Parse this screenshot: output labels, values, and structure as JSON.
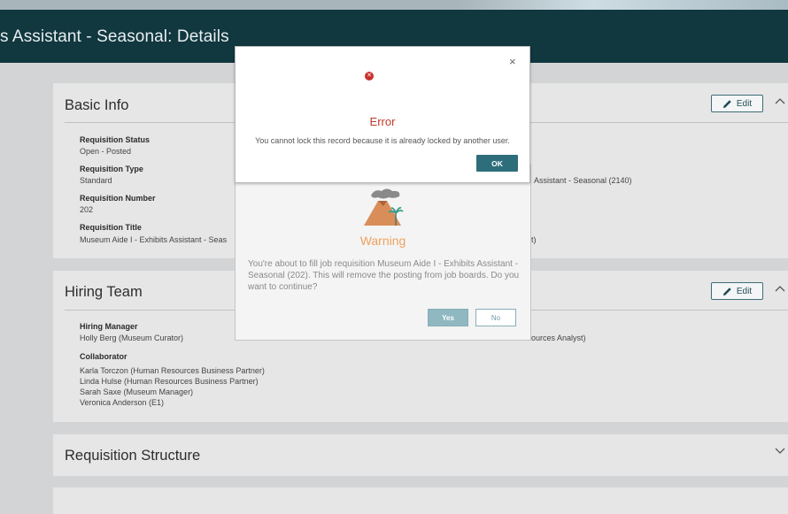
{
  "header": {
    "title": "s Assistant - Seasonal: Details"
  },
  "basic_info": {
    "title": "Basic Info",
    "edit_label": "Edit",
    "fields": [
      {
        "label": "Requisition Status",
        "value": "Open - Posted"
      },
      {
        "label": "Requisition Type",
        "value": "Standard"
      },
      {
        "label": "Requisition Number",
        "value": "202"
      },
      {
        "label": "Requisition Title",
        "value": "Museum Aide I - Exhibits Assistant - Seas"
      }
    ],
    "right_fragments": [
      "Assistant - Seasonal (2140)",
      "t)"
    ]
  },
  "hiring_team": {
    "title": "Hiring Team",
    "edit_label": "Edit",
    "hiring_manager_label": "Hiring Manager",
    "hiring_manager": "Holly Berg (Museum Curator)",
    "right_fragment": "ources Analyst)",
    "collaborator_label": "Collaborator",
    "collaborators": [
      "Karla Torczon (Human Resources Business Partner)",
      "Linda Hulse (Human Resources Business Partner)",
      "Sarah Saxe (Museum Manager)",
      "Veronica Anderson (E1)"
    ]
  },
  "requisition_structure": {
    "title": "Requisition Structure"
  },
  "warning_dialog": {
    "title": "Warning",
    "message": "You're about to fill job requisition Museum Aide I - Exhibits Assistant - Seasonal (202). This will remove the posting from job boards. Do you want to continue?",
    "yes_label": "Yes",
    "no_label": "No",
    "icon": "volcano-icon"
  },
  "error_dialog": {
    "title": "Error",
    "message": "You cannot lock this record because it is already locked by another user.",
    "ok_label": "OK",
    "close_glyph": "×",
    "icon_glyph": "✕",
    "icon": "error-icon"
  },
  "colors": {
    "header_bg": "#11373f",
    "accent": "#2e6e7a",
    "error": "#c0392b",
    "warning": "#efa25e"
  }
}
